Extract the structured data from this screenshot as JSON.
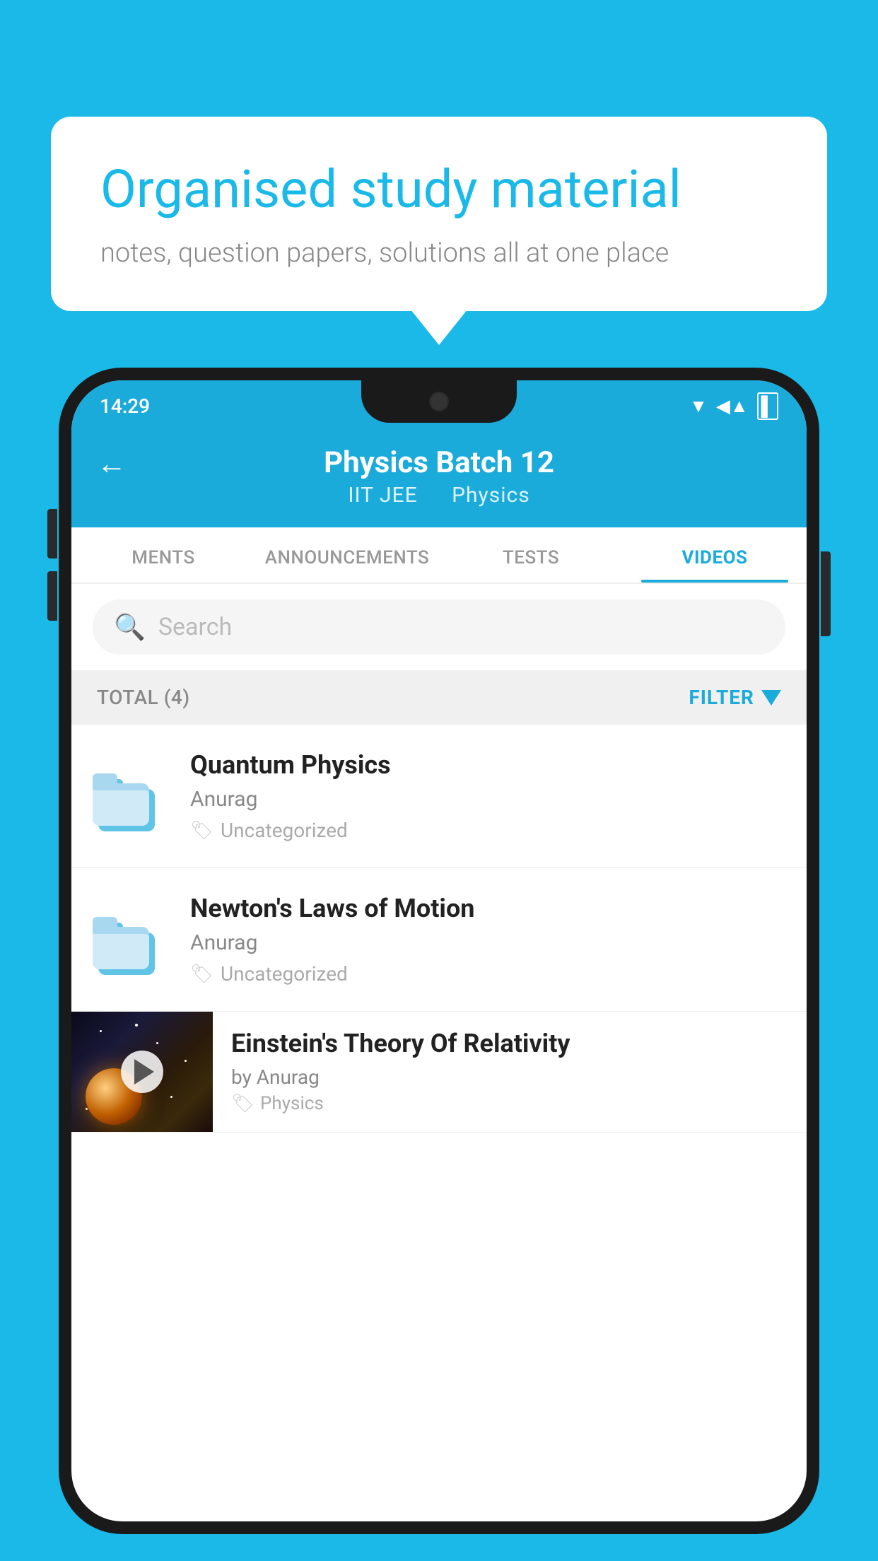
{
  "background_color": "#1ab9e8",
  "speech_bubble": {
    "heading": "Organised study material",
    "subtext": "notes, question papers, solutions all at one place"
  },
  "status_bar": {
    "time": "14:29",
    "wifi": "▲",
    "signal": "▲",
    "battery": "▌"
  },
  "app_header": {
    "back_label": "←",
    "title": "Physics Batch 12",
    "subtitle_part1": "IIT JEE",
    "subtitle_part2": "Physics"
  },
  "tabs": [
    {
      "label": "MENTS",
      "active": false
    },
    {
      "label": "ANNOUNCEMENTS",
      "active": false
    },
    {
      "label": "TESTS",
      "active": false
    },
    {
      "label": "VIDEOS",
      "active": true
    }
  ],
  "search": {
    "placeholder": "Search"
  },
  "filter_bar": {
    "total_label": "TOTAL (4)",
    "filter_label": "FILTER"
  },
  "videos": [
    {
      "title": "Quantum Physics",
      "author": "Anurag",
      "tag": "Uncategorized",
      "has_thumb": false
    },
    {
      "title": "Newton's Laws of Motion",
      "author": "Anurag",
      "tag": "Uncategorized",
      "has_thumb": false
    },
    {
      "title": "Einstein's Theory Of Relativity",
      "author": "by Anurag",
      "tag": "Physics",
      "has_thumb": true
    }
  ]
}
